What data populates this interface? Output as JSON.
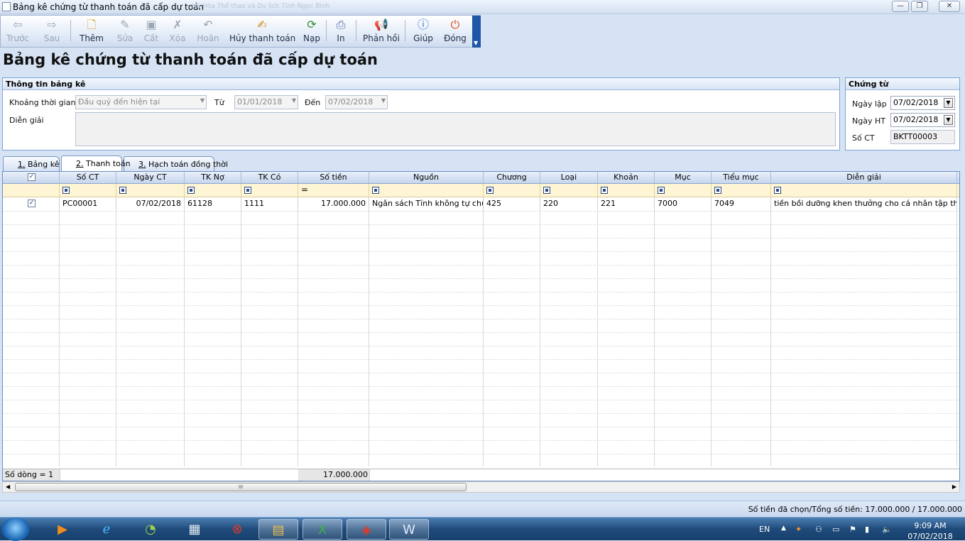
{
  "window": {
    "title": "Bảng kê chứng từ thanh toán đã cấp dự toán",
    "faint_text": "Hà Hòa Thể thao và Du lịch Tỉnh Ngọc Bình"
  },
  "toolbar": {
    "items": [
      {
        "label": "Trước",
        "icon": "arrow-left-icon",
        "disabled": true
      },
      {
        "label": "Sau",
        "icon": "arrow-right-icon",
        "disabled": true
      },
      {
        "label": "Thêm",
        "icon": "add-doc-icon",
        "disabled": false
      },
      {
        "label": "Sửa",
        "icon": "edit-icon",
        "disabled": true
      },
      {
        "label": "Cất",
        "icon": "save-icon",
        "disabled": true
      },
      {
        "label": "Xóa",
        "icon": "delete-icon",
        "disabled": true
      },
      {
        "label": "Hoãn",
        "icon": "undo-icon",
        "disabled": true
      },
      {
        "label": "Hủy thanh toán",
        "icon": "cancel-pay-icon",
        "disabled": false
      },
      {
        "label": "Nạp",
        "icon": "refresh-icon",
        "disabled": false
      },
      {
        "label": "In",
        "icon": "print-icon",
        "disabled": false
      },
      {
        "label": "Phản hồi",
        "icon": "megaphone-icon",
        "disabled": false
      },
      {
        "label": "Giúp",
        "icon": "help-icon",
        "disabled": false
      },
      {
        "label": "Đóng",
        "icon": "close-app-icon",
        "disabled": false
      }
    ]
  },
  "page_title": "Bảng kê chứng từ thanh toán đã cấp dự toán",
  "info_panel": {
    "title": "Thông tin bảng kê",
    "period_label": "Khoảng thời gian",
    "period_value": "Đầu quý đến hiện tại",
    "from_label": "Từ",
    "from_value": "01/01/2018",
    "to_label": "Đến",
    "to_value": "07/02/2018",
    "desc_label": "Diễn giải",
    "desc_value": ""
  },
  "voucher_panel": {
    "title": "Chứng từ",
    "date_label": "Ngày lập",
    "date_value": "07/02/2018",
    "ht_label": "Ngày HT",
    "ht_value": "07/02/2018",
    "no_label": "Số CT",
    "no_value": "BKTT00003"
  },
  "tabs": [
    {
      "num": "1.",
      "label": " Bảng kê"
    },
    {
      "num": "2.",
      "label": " Thanh toán"
    },
    {
      "num": "3.",
      "label": " Hạch toán đồng thời"
    }
  ],
  "grid": {
    "columns": [
      "Số CT",
      "Ngày CT",
      "TK Nợ",
      "TK Có",
      "Số tiền",
      "Nguồn",
      "Chương",
      "Loại",
      "Khoản",
      "Mục",
      "Tiểu mục",
      "Diễn giải"
    ],
    "rows": [
      {
        "checked": true,
        "cells": [
          "PC00001",
          "07/02/2018",
          "61128",
          "1111",
          "17.000.000",
          "Ngân sách Tỉnh không tự chủ",
          "425",
          "220",
          "221",
          "7000",
          "7049",
          "tiền bồi dưỡng khen thưởng cho cá nhân tập thể t..."
        ]
      }
    ],
    "footer_count": "Số dòng = 1",
    "footer_total": "17.000.000",
    "scroll_grip": "III"
  },
  "status": "Số tiền đã chọn/Tổng số tiền: 17.000.000 / 17.000.000",
  "taskbar": {
    "lang": "EN",
    "time": "9:09 AM",
    "date": "07/02/2018"
  }
}
